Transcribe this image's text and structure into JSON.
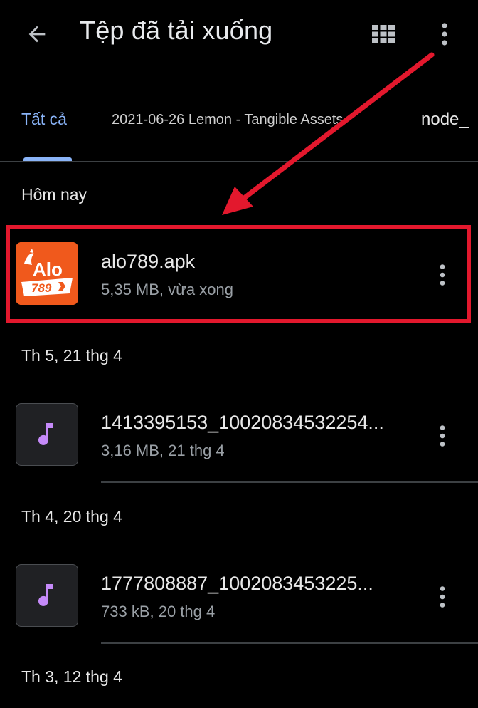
{
  "appbar": {
    "title": "Tệp đã tải xuống",
    "back_icon": "arrow-back-icon",
    "grid_icon": "grid-view-icon",
    "more_icon": "more-vert-icon"
  },
  "tabs": [
    {
      "label": "Tất cả",
      "selected": true
    },
    {
      "label": "2021-06-26 Lemon - Tangible Assets",
      "selected": false
    },
    {
      "label": "node_",
      "selected": false
    }
  ],
  "sections": [
    {
      "header": "Hôm nay",
      "items": [
        {
          "name": "alo789.apk",
          "meta": "5,35 MB, vừa xong",
          "thumb": "app-logo",
          "logo_text": "Alo",
          "logo_sub": "789"
        }
      ]
    },
    {
      "header": "Th 5, 21 thg 4",
      "items": [
        {
          "name": "1413395153_10020834532254...",
          "meta": "3,16 MB, 21 thg 4",
          "thumb": "music-note-icon"
        }
      ]
    },
    {
      "header": "Th 4, 20 thg 4",
      "items": [
        {
          "name": "1777808887_1002083453225...",
          "meta": "733 kB, 20 thg 4",
          "thumb": "music-note-icon"
        }
      ]
    },
    {
      "header": "Th 3, 12 thg 4",
      "items": []
    }
  ],
  "colors": {
    "background": "#000000",
    "accent": "#8ab4f8",
    "annotation": "#e3182d",
    "apk_icon": "#f0591c",
    "music_note": "#c58af9"
  }
}
